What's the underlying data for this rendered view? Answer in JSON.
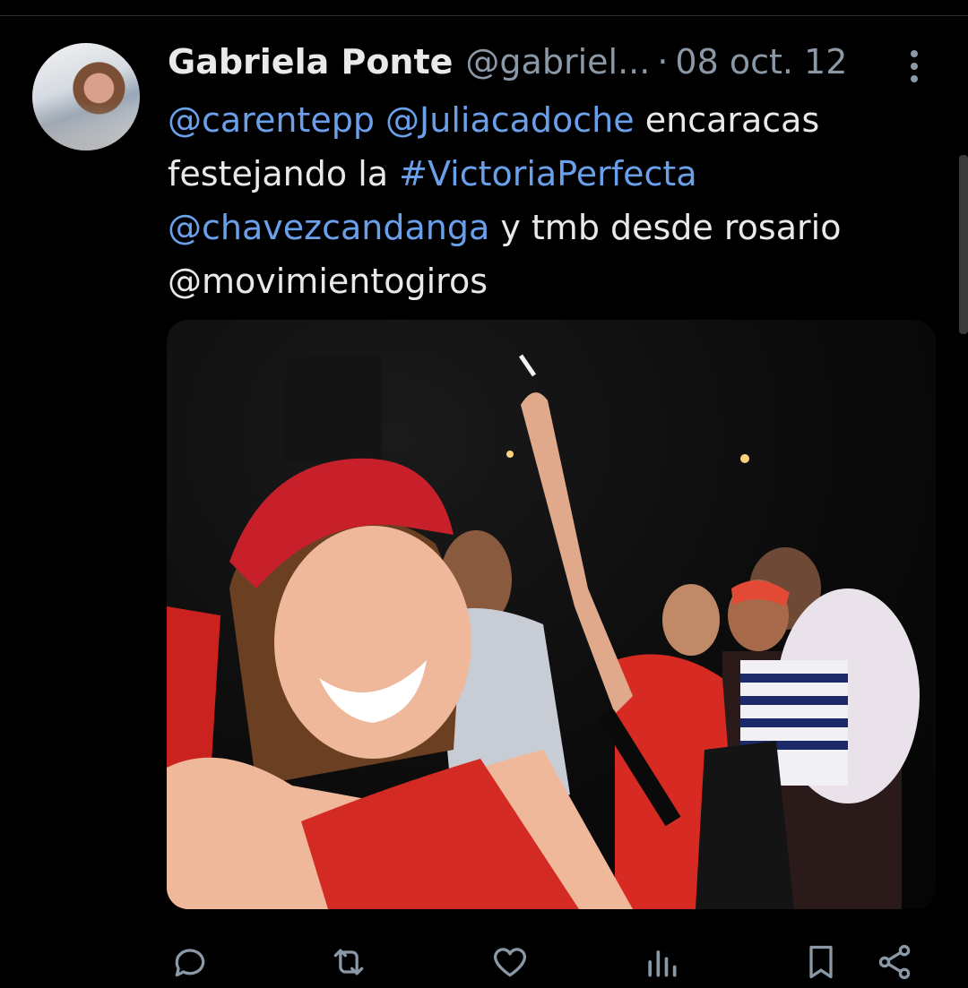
{
  "tweet": {
    "author": {
      "display_name": "Gabriela Ponte",
      "handle": "@gabriel...",
      "separator": "·",
      "date": "08 oct. 12"
    },
    "text_lines": [
      [
        {
          "t": "@carentepp",
          "link": true
        },
        {
          "t": " ",
          "link": false
        },
        {
          "t": "@Juliacadoche",
          "link": true
        },
        {
          "t": " encaracas",
          "link": false
        }
      ],
      [
        {
          "t": "festejando la ",
          "link": false
        },
        {
          "t": "#VictoriaPerfecta",
          "link": true
        }
      ],
      [
        {
          "t": "@chavezcandanga",
          "link": true
        },
        {
          "t": " y tmb desde rosario",
          "link": false
        }
      ],
      [
        {
          "t": "@movimientogiros",
          "link": false
        }
      ]
    ]
  },
  "actions": [
    "reply-icon",
    "retweet-icon",
    "like-icon",
    "views-icon",
    "bookmark-icon",
    "share-icon"
  ],
  "colors": {
    "background": "#000000",
    "text": "#e7e9ea",
    "secondary": "#8b98a5",
    "link": "#6a9fea",
    "cap_red": "#c8202a"
  }
}
